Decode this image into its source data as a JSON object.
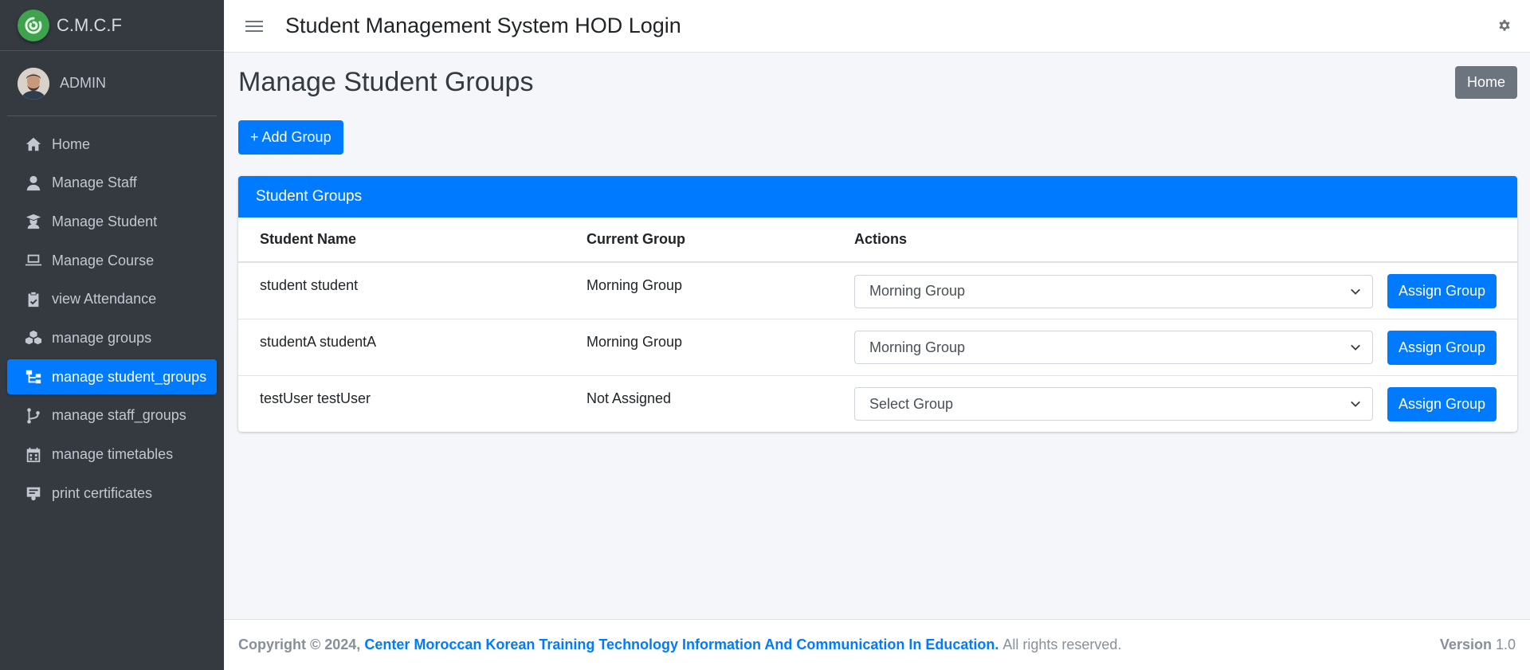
{
  "brand": {
    "name": "C.M.C.F",
    "icon": "logo-icon"
  },
  "user": {
    "name": "ADMIN",
    "avatar": "avatar"
  },
  "sidebar": {
    "items": [
      {
        "label": "Home",
        "icon": "home-icon",
        "active": false
      },
      {
        "label": "Manage Staff",
        "icon": "user-tie-icon",
        "active": false
      },
      {
        "label": "Manage Student",
        "icon": "user-graduate-icon",
        "active": false
      },
      {
        "label": "Manage Course",
        "icon": "laptop-icon",
        "active": false
      },
      {
        "label": "view Attendance",
        "icon": "clipboard-check-icon",
        "active": false
      },
      {
        "label": "manage groups",
        "icon": "cubes-icon",
        "active": false
      },
      {
        "label": "manage student_groups",
        "icon": "sitemap-icon",
        "active": true
      },
      {
        "label": "manage staff_groups",
        "icon": "code-branch-icon",
        "active": false
      },
      {
        "label": "manage timetables",
        "icon": "calendar-icon",
        "active": false
      },
      {
        "label": "print certificates",
        "icon": "certificate-icon",
        "active": false
      }
    ]
  },
  "header": {
    "title": "Student Management System HOD Login"
  },
  "main": {
    "page_title": "Manage Student Groups",
    "home_button": "Home",
    "add_button": "+ Add Group",
    "card_title": "Student Groups",
    "columns": [
      "Student Name",
      "Current Group",
      "Actions"
    ],
    "rows": [
      {
        "name": "student student",
        "group": "Morning Group",
        "select": "Morning Group",
        "button": "Assign Group"
      },
      {
        "name": "studentA studentA",
        "group": "Morning Group",
        "select": "Morning Group",
        "button": "Assign Group"
      },
      {
        "name": "testUser testUser",
        "group": "Not Assigned",
        "select": "Select Group",
        "button": "Assign Group"
      }
    ]
  },
  "footer": {
    "copyright": "Copyright © 2024,",
    "org": "Center Moroccan Korean Training Technology Information And Communication In Education.",
    "rights": "All rights reserved.",
    "version_label": "Version",
    "version": "1.0"
  },
  "colors": {
    "primary": "#007bff",
    "sidebar": "#343a40",
    "secondary": "#6c757d",
    "brand_logo": "#3fa34d"
  }
}
